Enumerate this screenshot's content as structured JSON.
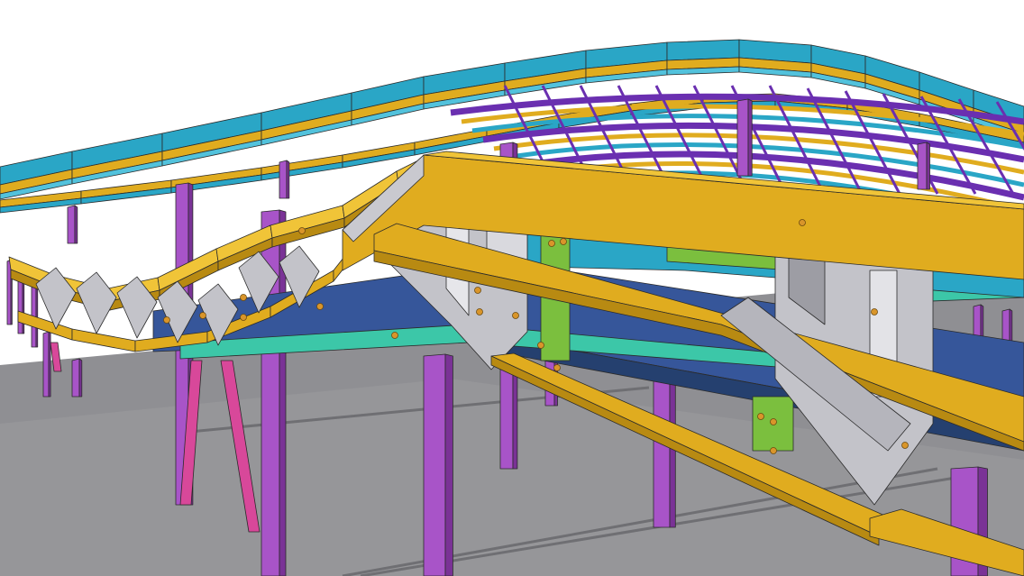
{
  "scene": {
    "description_free": true,
    "colors": {
      "background": "#ffffff",
      "ground": "#8f8f93",
      "ground_light": "#a2a2a6",
      "yellow_beam": "#e0ac1f",
      "yellow_beam_shade": "#b88a12",
      "yellow_beam_light": "#f0c438",
      "cyan_purlin": "#2aa6c6",
      "cyan_purlin_light": "#52c2dc",
      "violet_column": "#a854c8",
      "violet_column_dark": "#7a3296",
      "purple_roof": "#6a2fb0",
      "magenta_brace": "#d8489a",
      "navy_chord": "#36569a",
      "navy_chord_dark": "#25406f",
      "gray_plate": "#c3c3c9",
      "gray_plate_dark": "#9d9da4",
      "green_plate": "#7bbf3e",
      "teal_plate": "#3cc7a8",
      "bolt": "#d9952a",
      "edge": "#2b2b2b"
    }
  }
}
